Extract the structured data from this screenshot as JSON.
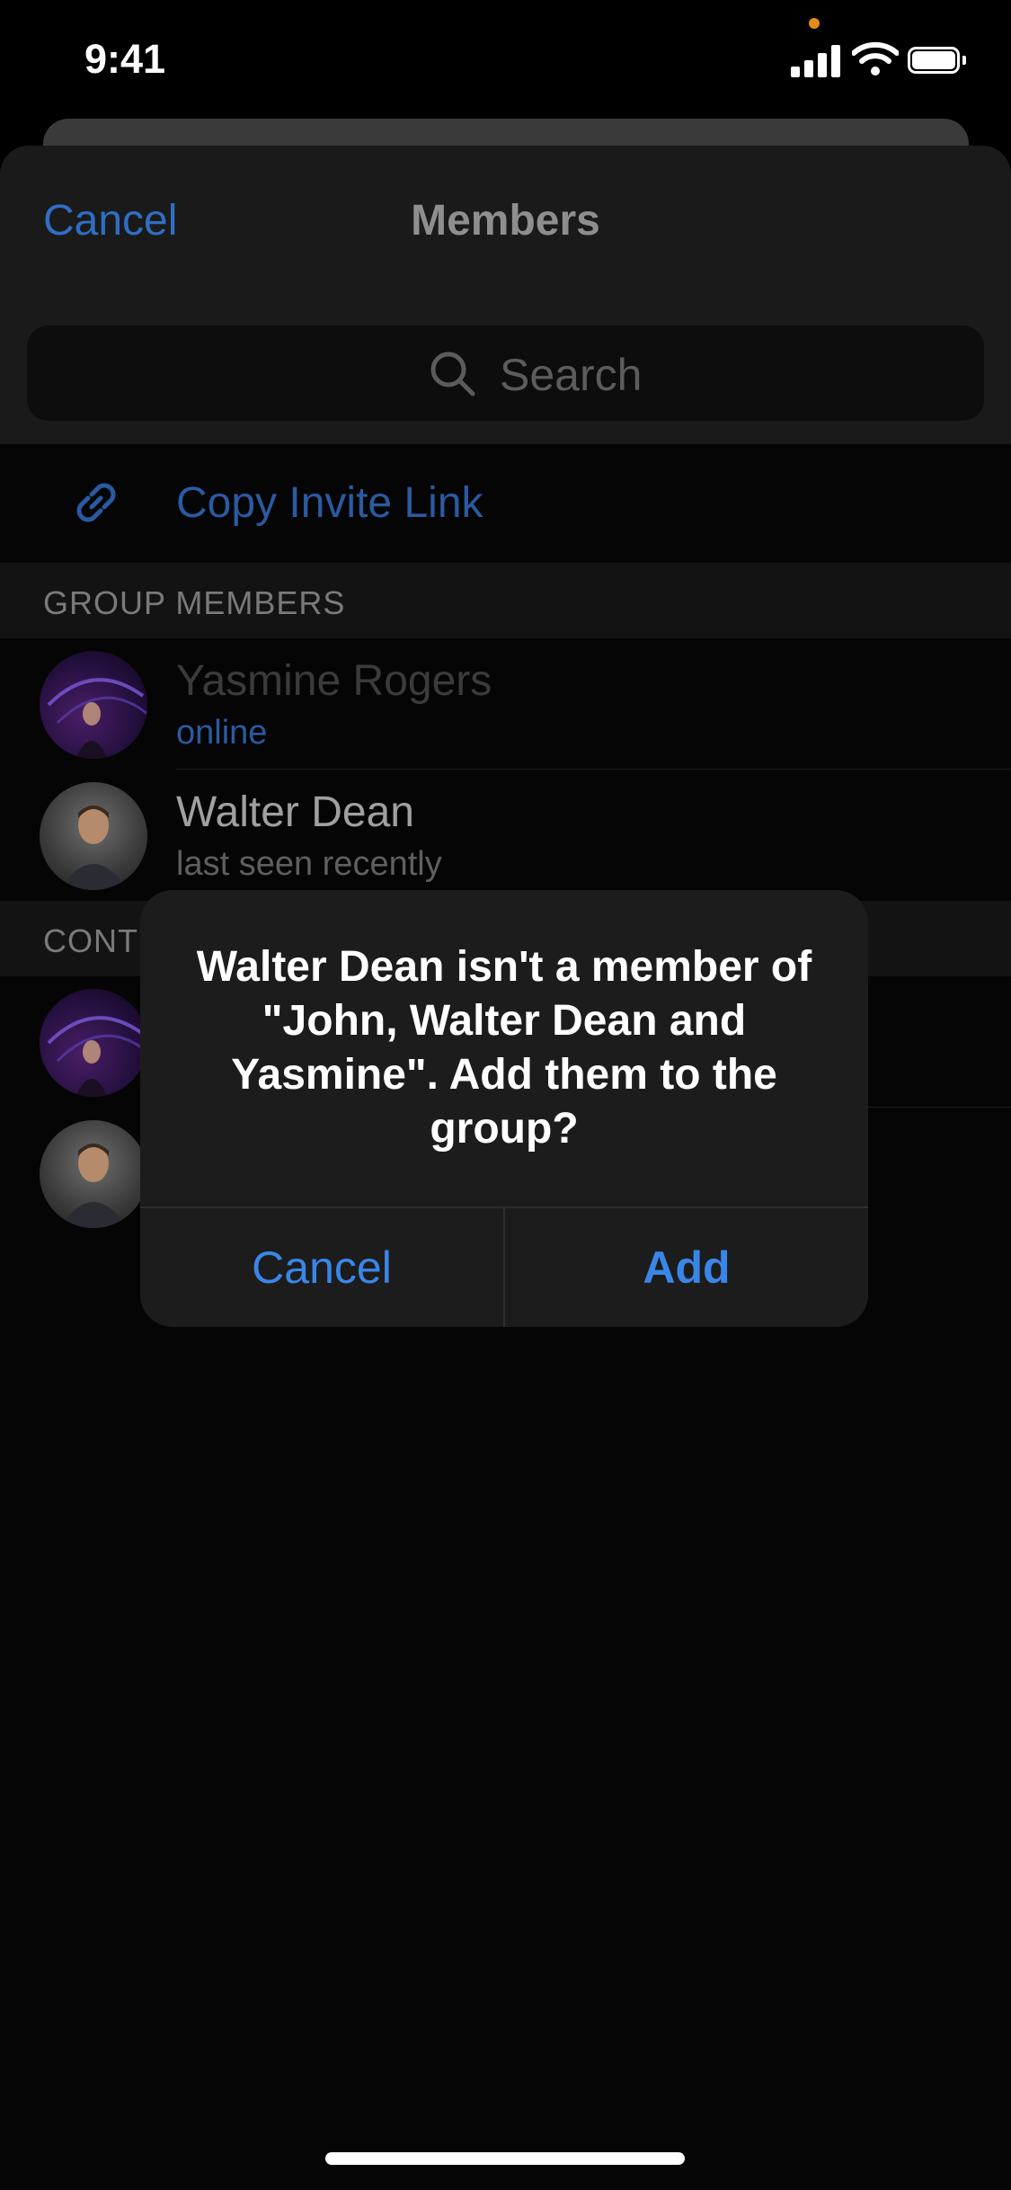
{
  "status_bar": {
    "time": "9:41",
    "icons": [
      "cellular-signal-icon",
      "wifi-icon",
      "battery-icon"
    ],
    "recording_dot_color": "#e58a1f"
  },
  "nav": {
    "cancel_label": "Cancel",
    "title": "Members"
  },
  "search": {
    "placeholder": "Search",
    "icon": "search-icon"
  },
  "invite": {
    "icon": "link-icon",
    "label": "Copy Invite Link"
  },
  "sections": {
    "group_members": "GROUP MEMBERS",
    "contacts": "CONT"
  },
  "group_members": [
    {
      "name": "Yasmine Rogers",
      "status": "online",
      "status_color": "#2a5aa2"
    },
    {
      "name": "Walter Dean",
      "status": "last seen recently",
      "status_color": "#5f5f5f"
    }
  ],
  "alert": {
    "message": "Walter Dean isn't a member of \"John, Walter Dean and Yasmine\". Add them to the group?",
    "cancel_label": "Cancel",
    "add_label": "Add"
  },
  "colors": {
    "accent": "#3a86e8",
    "dimmed_accent": "#2f6ec4",
    "background": "#000000",
    "alert_background": "#1c1c1c"
  }
}
